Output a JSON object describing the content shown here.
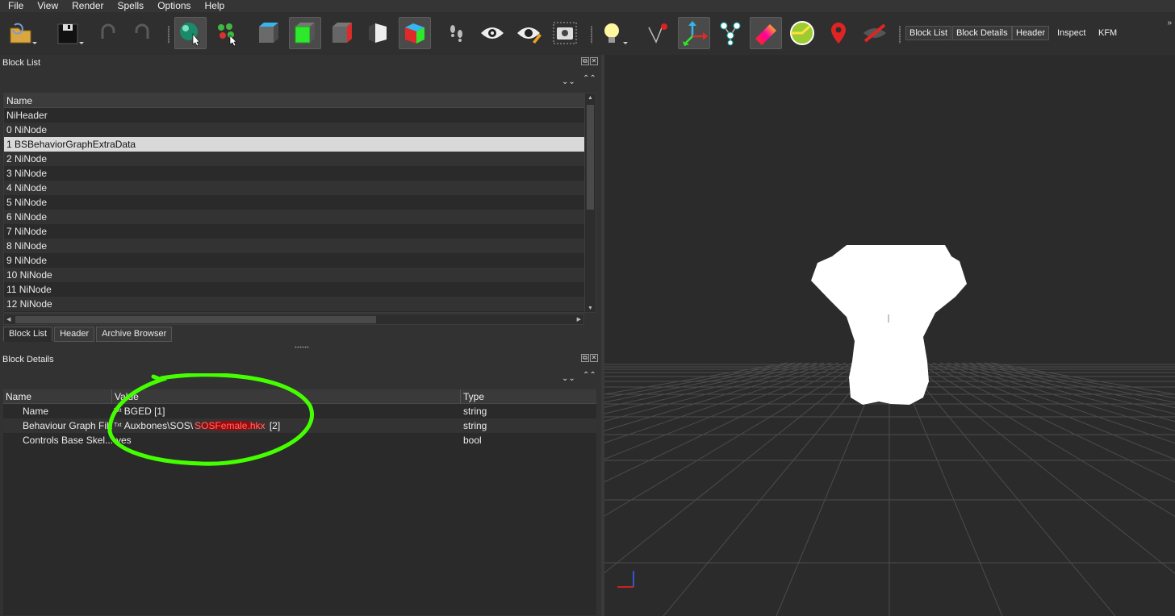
{
  "menu": [
    "File",
    "View",
    "Render",
    "Spells",
    "Options",
    "Help"
  ],
  "toolbar": {
    "icons": [
      "load-icon",
      "save-icon",
      "undo-icon",
      "redo-icon",
      "select-object-icon",
      "select-vertex-icon",
      "view-top-icon",
      "view-front-icon",
      "view-side-icon",
      "view-perspective-icon",
      "view-user-icon",
      "walk-icon",
      "show-hidden-icon",
      "hide-icon",
      "screenshot-icon",
      "lighting-icon",
      "show-markers-icon",
      "show-axes-icon",
      "show-nodes-icon",
      "show-bounds-icon",
      "show-collision-icon",
      "show-constraints-icon",
      "show-markers-pin-icon",
      "hide-lod-icon"
    ],
    "text_buttons": [
      "Block List",
      "Block Details",
      "Header",
      "Inspect",
      "KFM"
    ]
  },
  "block_list": {
    "title": "Block List",
    "column": "Name",
    "rows": [
      "NiHeader",
      "0 NiNode",
      "1 BSBehaviorGraphExtraData",
      "2 NiNode",
      "3 NiNode",
      "4 NiNode",
      "5 NiNode",
      "6 NiNode",
      "7 NiNode",
      "8 NiNode",
      "9 NiNode",
      "10 NiNode",
      "11 NiNode",
      "12 NiNode"
    ],
    "selected_index": 2
  },
  "tabs": [
    "Block List",
    "Header",
    "Archive Browser"
  ],
  "block_details": {
    "title": "Block Details",
    "columns": [
      "Name",
      "Value",
      "Type"
    ],
    "rows": [
      {
        "name": "Name",
        "icon": "Txt",
        "value": "BGED [1]",
        "value_hl": "",
        "value_suffix": "",
        "type": "string"
      },
      {
        "name": "Behaviour Graph File",
        "icon": "Txt",
        "value": "Auxbones\\SOS\\",
        "value_hl": "SOSFemale.hkx",
        "value_suffix": " [2]",
        "type": "string"
      },
      {
        "name": "Controls Base Skel...",
        "icon": "",
        "value": "yes",
        "value_hl": "",
        "value_suffix": "",
        "type": "bool"
      }
    ]
  },
  "colors": {
    "annotation": "#44ff00",
    "highlight": "#ff6b6b",
    "selection": "#d9d9d9"
  }
}
